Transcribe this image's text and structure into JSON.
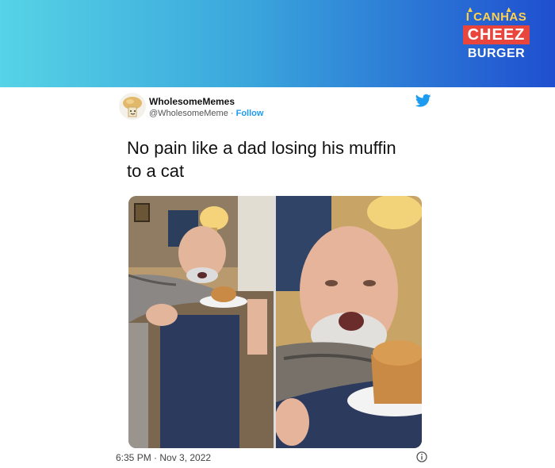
{
  "brand": {
    "line1": "I CANHAS",
    "line2": "CHEEZ",
    "line3": "BURGER"
  },
  "tweet": {
    "author_name": "WholesomeMemes",
    "author_handle": "@WholesomeMeme",
    "separator": " · ",
    "follow_label": "Follow",
    "text": "No pain like a dad losing his muffin to a cat",
    "timestamp": "6:35 PM · Nov 3, 2022"
  },
  "icons": {
    "platform": "twitter-bird-icon",
    "info": "info-icon"
  },
  "colors": {
    "banner_start": "#56d3e6",
    "banner_end": "#1f4fd0",
    "twitter_blue": "#1d9bf0",
    "brand_yellow": "#ffd24a",
    "brand_red": "#e8453c"
  }
}
